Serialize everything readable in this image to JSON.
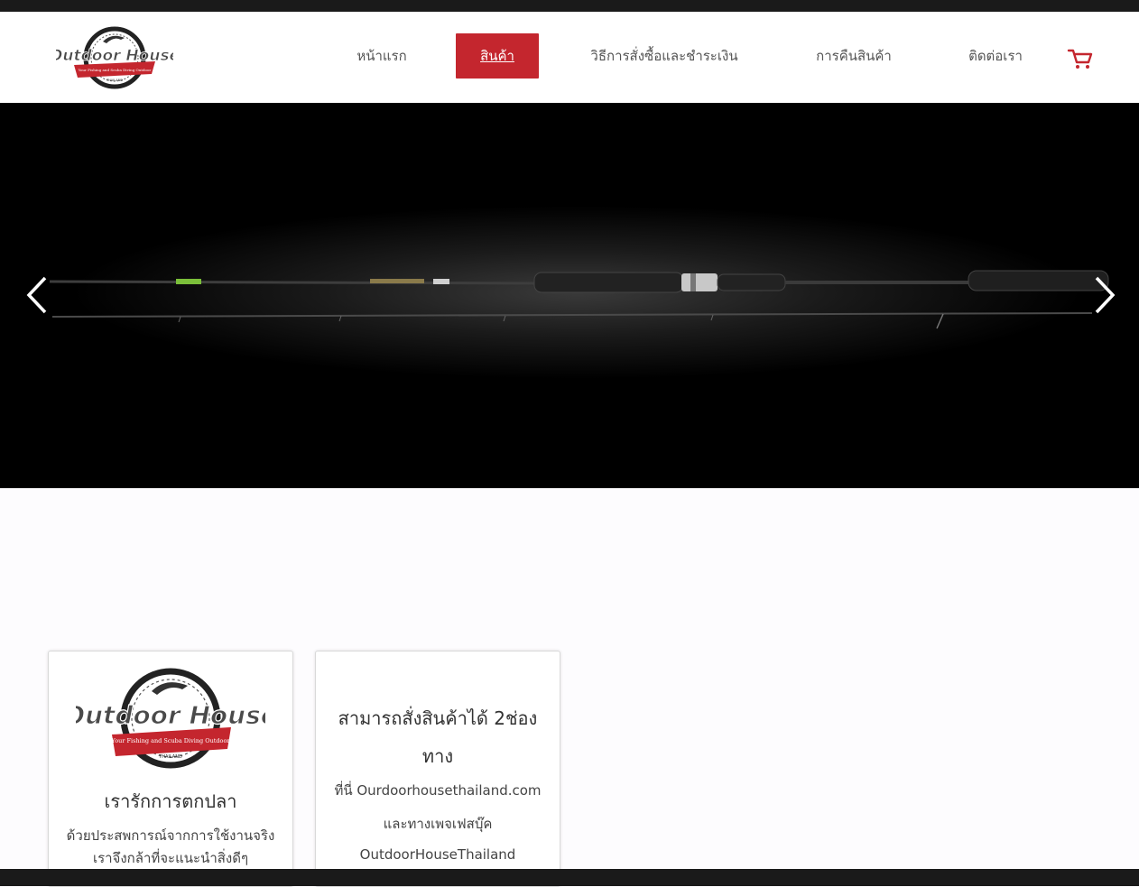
{
  "header": {
    "logo": {
      "text": "Outdoor House",
      "tagline": "Your Fishing and Scuba Diving Outdoor",
      "country": "THAILAND"
    },
    "nav": {
      "home": "หน้าแรก",
      "products": "สินค้า",
      "howto": "วิธีการสั่งซื้อและชำระเงิน",
      "returns": "การคืนสินค้า",
      "contact": "ติดต่อเรา"
    },
    "cart_icon": "shopping-cart-icon"
  },
  "hero": {
    "prev_icon": "chevron-left-icon",
    "next_icon": "chevron-right-icon"
  },
  "cards": {
    "card1": {
      "logo_text": "Outdoor House",
      "logo_tagline": "Your Fishing and Scuba Diving Outdoor",
      "logo_country": "THAILAND",
      "title": "เรารักการตกปลา",
      "text": "ด้วยประสพการณ์จากการใช้งานจริง เราจึงกล้าที่จะแนะนำสิ่งดีๆ"
    },
    "card2": {
      "title": "สามารถสั่งสินค้าได้ 2ช่องทาง",
      "line1": "ที่นี่ Ourdoorhousethailand.com",
      "line2": "และทางเพจเฟสบุ๊ค",
      "line3": "OutdoorHouseThailand"
    }
  },
  "colors": {
    "accent": "#c4262e",
    "header_bg": "#ffffff",
    "hero_bg": "#000000"
  }
}
